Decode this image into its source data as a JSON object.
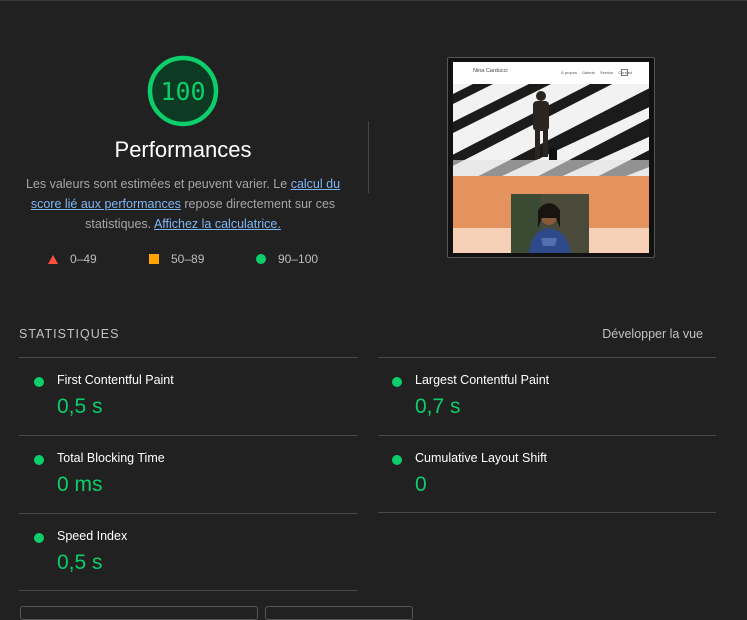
{
  "score": {
    "value": "100",
    "fraction": 1.0,
    "color": "#0cce6b"
  },
  "category_title": "Performances",
  "description": {
    "text1": "Les valeurs sont estimées et peuvent varier. Le ",
    "link1": "calcul du score lié aux performances",
    "text2": " repose directement sur ces statistiques. ",
    "link2": "Affichez la calculatrice."
  },
  "legend": [
    {
      "range": "0–49",
      "shape": "triangle",
      "color": "#ff4e42"
    },
    {
      "range": "50–89",
      "shape": "square",
      "color": "#ffa400"
    },
    {
      "range": "90–100",
      "shape": "circle",
      "color": "#0cce6b"
    }
  ],
  "thumbnail": {
    "brand": "Nina Carducci",
    "nav_links": [
      "À propos",
      "Galerie",
      "Service",
      "Contact"
    ]
  },
  "statistics": {
    "title": "STATISTIQUES",
    "expand_label": "Développer la vue",
    "metrics": [
      {
        "label": "First Contentful Paint",
        "value": "0,5 s",
        "status": "good"
      },
      {
        "label": "Largest Contentful Paint",
        "value": "0,7 s",
        "status": "good"
      },
      {
        "label": "Total Blocking Time",
        "value": "0 ms",
        "status": "good"
      },
      {
        "label": "Cumulative Layout Shift",
        "value": "0",
        "status": "good"
      },
      {
        "label": "Speed Index",
        "value": "0,5 s",
        "status": "good"
      }
    ]
  }
}
